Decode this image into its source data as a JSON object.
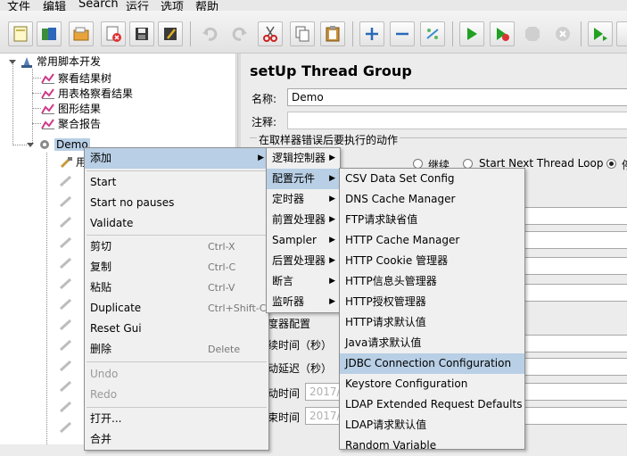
{
  "menubar": [
    "文件",
    "编辑",
    "Search",
    "运行",
    "选项",
    "帮助"
  ],
  "tree": {
    "root": "常用脚本开发",
    "children": [
      "察看结果树",
      "用表格察看结果",
      "图形结果",
      "聚合报告"
    ],
    "selected": "Demo",
    "partial_child": "用"
  },
  "panel": {
    "title": "setUp Thread Group",
    "name_label": "名称:",
    "name_value": "Demo",
    "comment_label": "注释:",
    "error_action_title": "在取样器错误后要执行的动作",
    "radio_continue": "继续",
    "radio_next_loop": "Start Next Thread Loop",
    "radio_stop": "停",
    "scheduler_config": "度器配置",
    "duration_label": "续时间（秒）",
    "delay_label": "动延迟（秒）",
    "start_time_label": "动时间",
    "start_time_value": "2017/0",
    "end_time_label": "束时间",
    "end_time_value": "2017/0"
  },
  "context_menu": {
    "add": "添加",
    "start": "Start",
    "start_no_pauses": "Start no pauses",
    "validate": "Validate",
    "cut": "剪切",
    "cut_key": "Ctrl-X",
    "copy": "复制",
    "copy_key": "Ctrl-C",
    "paste": "粘贴",
    "paste_key": "Ctrl-V",
    "duplicate": "Duplicate",
    "duplicate_key": "Ctrl+Shift-C",
    "reset_gui": "Reset Gui",
    "delete": "删除",
    "delete_key": "Delete",
    "undo": "Undo",
    "redo": "Redo",
    "open": "打开...",
    "merge": "合并"
  },
  "submenu_add": [
    "逻辑控制器",
    "配置元件",
    "定时器",
    "前置处理器",
    "Sampler",
    "后置处理器",
    "断言",
    "监听器"
  ],
  "submenu_config": [
    "CSV Data Set Config",
    "DNS Cache Manager",
    "FTP请求缺省值",
    "HTTP Cache Manager",
    "HTTP Cookie 管理器",
    "HTTP信息头管理器",
    "HTTP授权管理器",
    "HTTP请求默认值",
    "Java请求默认值",
    "JDBC Connection Configuration",
    "Keystore Configuration",
    "LDAP Extended Request Defaults",
    "LDAP请求默认值",
    "Random Variable"
  ],
  "colors": {
    "highlight": "#b8cfe5",
    "menu_bg": "#f0f0f0"
  }
}
